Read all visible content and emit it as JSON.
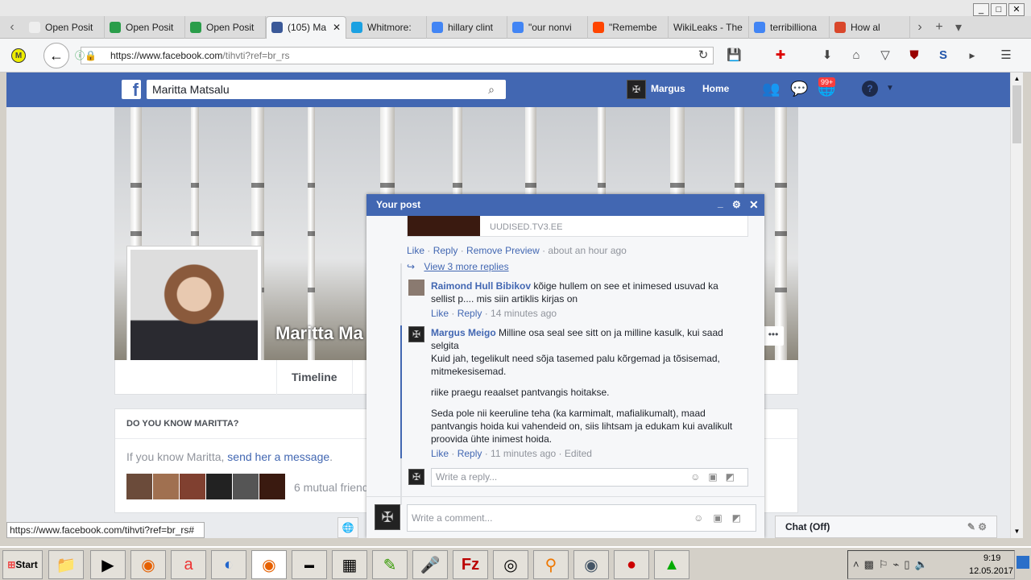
{
  "browser": {
    "tabs": [
      {
        "label": "Open Posit",
        "icon": "page-icon",
        "color": "#eee"
      },
      {
        "label": "Open Posit",
        "icon": "green-circle-icon",
        "color": "#2a9d4a"
      },
      {
        "label": "Open Posit",
        "icon": "green-circle-icon",
        "color": "#2a9d4a"
      },
      {
        "label": "(105) Ma",
        "icon": "facebook-icon",
        "color": "#3b5998",
        "active": true
      },
      {
        "label": "Whitmore:",
        "icon": "blue-circle-icon",
        "color": "#1ba1e2"
      },
      {
        "label": "hillary clint",
        "icon": "google-icon",
        "color": "#4285f4"
      },
      {
        "label": "\"our nonvi",
        "icon": "google-icon",
        "color": "#4285f4"
      },
      {
        "label": "\"Remembe",
        "icon": "reddit-icon",
        "color": "#ff4500"
      },
      {
        "label": "WikiLeaks - The",
        "icon": "",
        "color": ""
      },
      {
        "label": "terribilliona",
        "icon": "google-icon",
        "color": "#4285f4"
      },
      {
        "label": "How al",
        "icon": "gw-icon",
        "color": "#d9472b"
      }
    ],
    "url_host": "https://www.facebook.com",
    "url_path": "/tihvti?ref=br_rs",
    "status_url": "https://www.facebook.com/tihvti?ref=br_rs#"
  },
  "fb": {
    "search_value": "Maritta Matsalu",
    "user": "Margus",
    "home": "Home",
    "notif_badge": "99+",
    "profile_name": "Maritta Ma",
    "timeline_tab": "Timeline",
    "know_title": "DO YOU KNOW MARITTA?",
    "know_text": "If you know Maritta, ",
    "know_link": "send her a message",
    "know_end": ".",
    "mutual": "6 mutual friend",
    "chat": "Chat (Off)"
  },
  "popup": {
    "title": "Your post",
    "preview_source": "UUDISED.TV3.EE",
    "actions1": {
      "like": "Like",
      "reply": "Reply",
      "remove": "Remove Preview",
      "time": "about an hour ago"
    },
    "view_more": "View 3 more replies",
    "comments": [
      {
        "author": "Raimond Hull Bibikov",
        "text": "kõige hullem on see et inimesed usuvad ka sellist p.... mis siin artiklis kirjas on",
        "like": "Like",
        "reply": "Reply",
        "time": "14 minutes ago",
        "edited": ""
      },
      {
        "author": "Margus Meigo",
        "text": "Milline osa seal see sitt on ja milline kasulk, kui saad selgita",
        "paragraphs": [
          "Kuid jah, tegelikult need sõja tasemed palu kõrgemad ja tõsisemad, mitmekesisemad.",
          "riike praegu reaalset pantvangis hoitakse.",
          "Seda pole nii keeruline teha (ka karmimalt, mafialikumalt), maad pantvangis hoida kui vahendeid on, siis lihtsam ja edukam kui avalikult proovida ühte inimest hoida."
        ],
        "like": "Like",
        "reply": "Reply",
        "time": "11 minutes ago",
        "edited": "Edited"
      }
    ],
    "reply_placeholder": "Write a reply...",
    "comment_placeholder": "Write a comment..."
  },
  "taskbar": {
    "start": "Start",
    "time": "9:19",
    "date": "12.05.2017"
  }
}
